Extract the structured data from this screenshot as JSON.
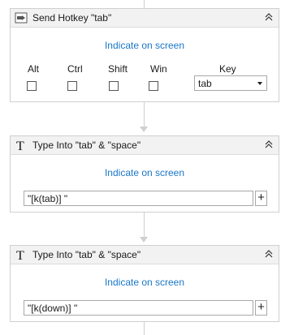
{
  "activities": [
    {
      "title": "Send Hotkey \"tab\"",
      "icon": "send-hotkey-icon",
      "indicate_label": "Indicate on screen",
      "modifiers": [
        "Alt",
        "Ctrl",
        "Shift",
        "Win"
      ],
      "key_label": "Key",
      "key_value": "tab"
    },
    {
      "title": "Type Into \"tab\" & \"space\"",
      "icon": "type-into-icon",
      "indicate_label": "Indicate on screen",
      "text_value": "\"[k(tab)] \"",
      "plus_label": "+"
    },
    {
      "title": "Type Into \"tab\" & \"space\"",
      "icon": "type-into-icon",
      "indicate_label": "Indicate on screen",
      "text_value": "\"[k(down)] \"",
      "plus_label": "+"
    }
  ],
  "colors": {
    "link": "#1a76c8",
    "header_bg": "#f2f2f2",
    "border": "#cfcfcf"
  }
}
